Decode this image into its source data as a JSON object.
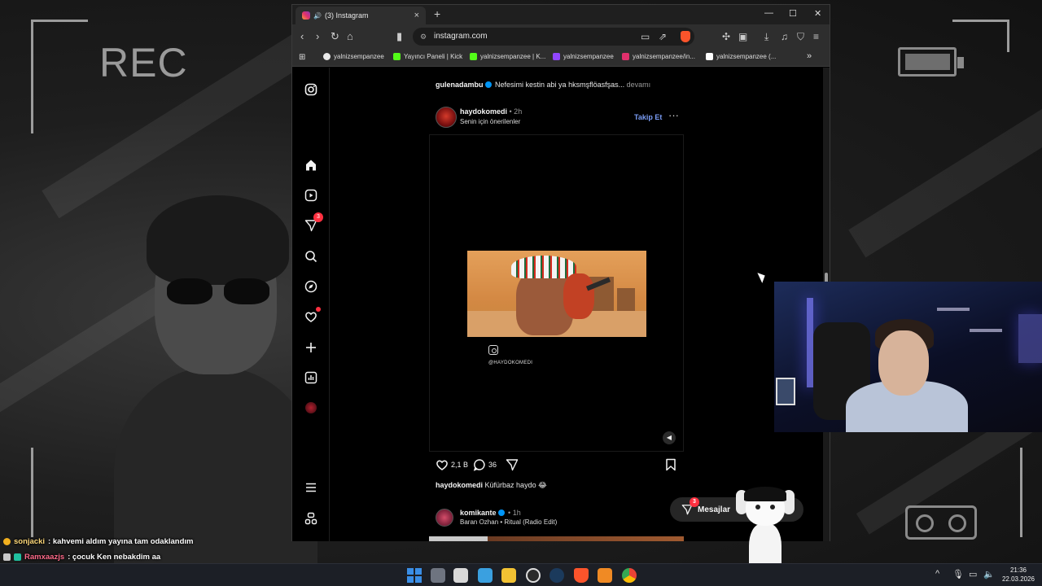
{
  "overlay": {
    "rec_label": "REC"
  },
  "browser": {
    "tab_title": "(3) Instagram",
    "tab_close": "×",
    "new_tab": "+",
    "url": "instagram.com",
    "bookmarks": [
      {
        "label": "yalnizsempanzee",
        "color": "#eaeaea"
      },
      {
        "label": "Yayıncı Paneli | Kick",
        "color": "#53fc18"
      },
      {
        "label": "yalnizsempanzee | K...",
        "color": "#53fc18"
      },
      {
        "label": "yalnizsempanzee",
        "color": "#9146ff"
      },
      {
        "label": "yalnizsempanzee/in...",
        "color": "#e1306c"
      },
      {
        "label": "yalnizsempanzee (...",
        "color": "#ffffff"
      }
    ],
    "more_bookmarks": "»"
  },
  "instagram": {
    "sidebar": {
      "messages_badge": "3",
      "items": [
        "instagram-logo-icon",
        "home-icon",
        "reels-icon",
        "messages-icon",
        "search-icon",
        "explore-icon",
        "notifications-icon",
        "create-icon",
        "dashboard-icon",
        "profile-avatar",
        "menu-icon",
        "threads-icon"
      ]
    },
    "previous_post": {
      "username": "gulenadambu",
      "caption": "Nefesimi kestin abi ya hksmşflöasfşas...",
      "more": "devamı"
    },
    "post": {
      "username": "haydokomedi",
      "time": "• 2h",
      "subtitle": "Senin için önerilenler",
      "follow_label": "Takip Et",
      "more": "···",
      "watermark": "@HAYDOKOMEDI",
      "likes": "2,1 B",
      "comments": "36",
      "caption_user": "haydokomedi",
      "caption_text": "Küfürbaz haydo 😂"
    },
    "next_post": {
      "username": "komikante",
      "time": "• 1h",
      "subtitle": "Baran Ozhan • Ritual (Radio Edit)"
    },
    "messages_pill": {
      "label": "Mesajlar",
      "badge": "3"
    }
  },
  "chat": [
    {
      "user": "sonjacki",
      "message": ": kahvemi aldım yayına tam odaklandım"
    },
    {
      "user": "Ramxaazjs",
      "message": ": çocuk Ken nebakdim aa"
    }
  ],
  "taskbar": {
    "time": "21:36",
    "date": "22.03.2026"
  }
}
